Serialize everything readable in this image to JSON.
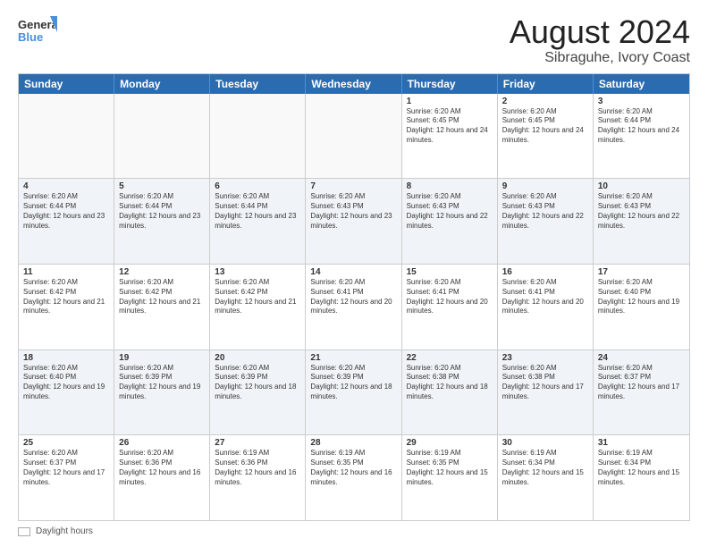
{
  "header": {
    "logo_line1": "General",
    "logo_line2": "Blue",
    "main_title": "August 2024",
    "sub_title": "Sibraguhe, Ivory Coast"
  },
  "days_of_week": [
    "Sunday",
    "Monday",
    "Tuesday",
    "Wednesday",
    "Thursday",
    "Friday",
    "Saturday"
  ],
  "weeks": [
    [
      {
        "day": "",
        "info": ""
      },
      {
        "day": "",
        "info": ""
      },
      {
        "day": "",
        "info": ""
      },
      {
        "day": "",
        "info": ""
      },
      {
        "day": "1",
        "info": "Sunrise: 6:20 AM\nSunset: 6:45 PM\nDaylight: 12 hours and 24 minutes."
      },
      {
        "day": "2",
        "info": "Sunrise: 6:20 AM\nSunset: 6:45 PM\nDaylight: 12 hours and 24 minutes."
      },
      {
        "day": "3",
        "info": "Sunrise: 6:20 AM\nSunset: 6:44 PM\nDaylight: 12 hours and 24 minutes."
      }
    ],
    [
      {
        "day": "4",
        "info": "Sunrise: 6:20 AM\nSunset: 6:44 PM\nDaylight: 12 hours and 23 minutes."
      },
      {
        "day": "5",
        "info": "Sunrise: 6:20 AM\nSunset: 6:44 PM\nDaylight: 12 hours and 23 minutes."
      },
      {
        "day": "6",
        "info": "Sunrise: 6:20 AM\nSunset: 6:44 PM\nDaylight: 12 hours and 23 minutes."
      },
      {
        "day": "7",
        "info": "Sunrise: 6:20 AM\nSunset: 6:43 PM\nDaylight: 12 hours and 23 minutes."
      },
      {
        "day": "8",
        "info": "Sunrise: 6:20 AM\nSunset: 6:43 PM\nDaylight: 12 hours and 22 minutes."
      },
      {
        "day": "9",
        "info": "Sunrise: 6:20 AM\nSunset: 6:43 PM\nDaylight: 12 hours and 22 minutes."
      },
      {
        "day": "10",
        "info": "Sunrise: 6:20 AM\nSunset: 6:43 PM\nDaylight: 12 hours and 22 minutes."
      }
    ],
    [
      {
        "day": "11",
        "info": "Sunrise: 6:20 AM\nSunset: 6:42 PM\nDaylight: 12 hours and 21 minutes."
      },
      {
        "day": "12",
        "info": "Sunrise: 6:20 AM\nSunset: 6:42 PM\nDaylight: 12 hours and 21 minutes."
      },
      {
        "day": "13",
        "info": "Sunrise: 6:20 AM\nSunset: 6:42 PM\nDaylight: 12 hours and 21 minutes."
      },
      {
        "day": "14",
        "info": "Sunrise: 6:20 AM\nSunset: 6:41 PM\nDaylight: 12 hours and 20 minutes."
      },
      {
        "day": "15",
        "info": "Sunrise: 6:20 AM\nSunset: 6:41 PM\nDaylight: 12 hours and 20 minutes."
      },
      {
        "day": "16",
        "info": "Sunrise: 6:20 AM\nSunset: 6:41 PM\nDaylight: 12 hours and 20 minutes."
      },
      {
        "day": "17",
        "info": "Sunrise: 6:20 AM\nSunset: 6:40 PM\nDaylight: 12 hours and 19 minutes."
      }
    ],
    [
      {
        "day": "18",
        "info": "Sunrise: 6:20 AM\nSunset: 6:40 PM\nDaylight: 12 hours and 19 minutes."
      },
      {
        "day": "19",
        "info": "Sunrise: 6:20 AM\nSunset: 6:39 PM\nDaylight: 12 hours and 19 minutes."
      },
      {
        "day": "20",
        "info": "Sunrise: 6:20 AM\nSunset: 6:39 PM\nDaylight: 12 hours and 18 minutes."
      },
      {
        "day": "21",
        "info": "Sunrise: 6:20 AM\nSunset: 6:39 PM\nDaylight: 12 hours and 18 minutes."
      },
      {
        "day": "22",
        "info": "Sunrise: 6:20 AM\nSunset: 6:38 PM\nDaylight: 12 hours and 18 minutes."
      },
      {
        "day": "23",
        "info": "Sunrise: 6:20 AM\nSunset: 6:38 PM\nDaylight: 12 hours and 17 minutes."
      },
      {
        "day": "24",
        "info": "Sunrise: 6:20 AM\nSunset: 6:37 PM\nDaylight: 12 hours and 17 minutes."
      }
    ],
    [
      {
        "day": "25",
        "info": "Sunrise: 6:20 AM\nSunset: 6:37 PM\nDaylight: 12 hours and 17 minutes."
      },
      {
        "day": "26",
        "info": "Sunrise: 6:20 AM\nSunset: 6:36 PM\nDaylight: 12 hours and 16 minutes."
      },
      {
        "day": "27",
        "info": "Sunrise: 6:19 AM\nSunset: 6:36 PM\nDaylight: 12 hours and 16 minutes."
      },
      {
        "day": "28",
        "info": "Sunrise: 6:19 AM\nSunset: 6:35 PM\nDaylight: 12 hours and 16 minutes."
      },
      {
        "day": "29",
        "info": "Sunrise: 6:19 AM\nSunset: 6:35 PM\nDaylight: 12 hours and 15 minutes."
      },
      {
        "day": "30",
        "info": "Sunrise: 6:19 AM\nSunset: 6:34 PM\nDaylight: 12 hours and 15 minutes."
      },
      {
        "day": "31",
        "info": "Sunrise: 6:19 AM\nSunset: 6:34 PM\nDaylight: 12 hours and 15 minutes."
      }
    ]
  ],
  "footer": {
    "label": "Daylight hours"
  }
}
